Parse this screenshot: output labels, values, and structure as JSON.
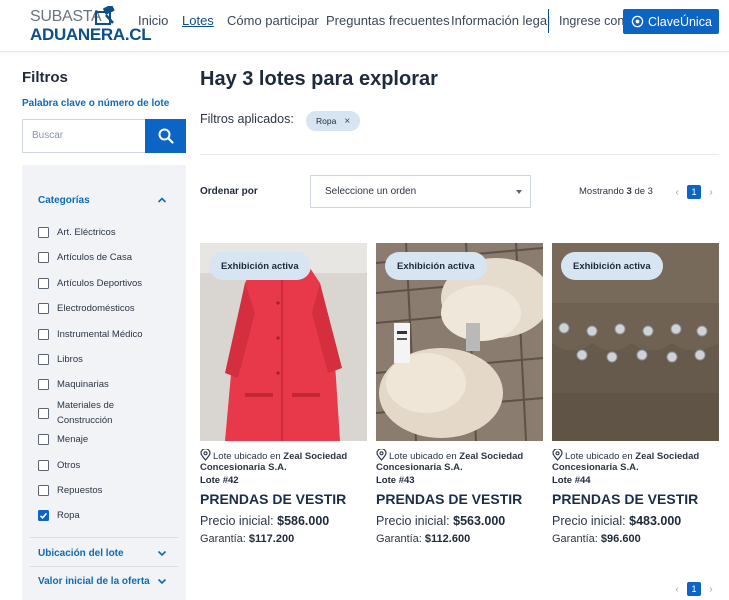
{
  "header": {
    "logo_top": "SUBASTA",
    "logo_bottom": "ADUANERA.CL",
    "nav": [
      "Inicio",
      "Lotes",
      "Cómo participar",
      "Preguntas frecuentes",
      "Información legal"
    ],
    "login_label": "Ingrese con",
    "clave_button": "ClaveÚnica"
  },
  "sidebar": {
    "title": "Filtros",
    "keyword_label": "Palabra clave o número de lote",
    "search_placeholder": "Buscar",
    "categories_title": "Categorías",
    "categories": [
      {
        "label": "Art. Eléctricos",
        "checked": false
      },
      {
        "label": "Artículos de Casa",
        "checked": false
      },
      {
        "label": "Artículos Deportivos",
        "checked": false
      },
      {
        "label": "Electrodomésticos",
        "checked": false
      },
      {
        "label": "Instrumental Médico",
        "checked": false
      },
      {
        "label": "Libros",
        "checked": false
      },
      {
        "label": "Maquinarias",
        "checked": false
      },
      {
        "label": "Materiales de Construcción",
        "checked": false
      },
      {
        "label": "Menaje",
        "checked": false
      },
      {
        "label": "Otros",
        "checked": false
      },
      {
        "label": "Repuestos",
        "checked": false
      },
      {
        "label": "Ropa",
        "checked": true
      }
    ],
    "location_title": "Ubicación del lote",
    "value_title": "Valor inicial de la oferta"
  },
  "main": {
    "title": "Hay 3 lotes para explorar",
    "applied_label": "Filtros aplicados:",
    "applied_chip": "Ropa",
    "sort_label": "Ordenar por",
    "sort_value": "Seleccione un orden",
    "showing_prefix": "Mostrando",
    "showing_count": "3",
    "showing_suffix": "de 3",
    "page": "1"
  },
  "lots": [
    {
      "badge": "Exhibición activa",
      "loc_prefix": "Lote ubicado en",
      "loc_name": "Zeal Sociedad Concesionaria S.A.",
      "lot_number": "Lote #42",
      "title": "PRENDAS DE VESTIR",
      "price_label": "Precio inicial:",
      "price_value": "$586.000",
      "guar_label": "Garantía:",
      "guar_value": "$117.200"
    },
    {
      "badge": "Exhibición activa",
      "loc_prefix": "Lote ubicado en",
      "loc_name": "Zeal Sociedad Concesionaria S.A.",
      "lot_number": "Lote #43",
      "title": "PRENDAS DE VESTIR",
      "price_label": "Precio inicial:",
      "price_value": "$563.000",
      "guar_label": "Garantía:",
      "guar_value": "$112.600"
    },
    {
      "badge": "Exhibición activa",
      "loc_prefix": "Lote ubicado en",
      "loc_name": "Zeal Sociedad Concesionaria S.A.",
      "lot_number": "Lote #44",
      "title": "PRENDAS DE VESTIR",
      "price_label": "Precio inicial:",
      "price_value": "$483.000",
      "guar_label": "Garantía:",
      "guar_value": "$96.600"
    }
  ],
  "colors": {
    "brand_blue": "#0c64c4",
    "link_blue": "#0d6bb8",
    "chip_bg": "#d7e4f1",
    "panel_bg": "#f1f3f6"
  }
}
